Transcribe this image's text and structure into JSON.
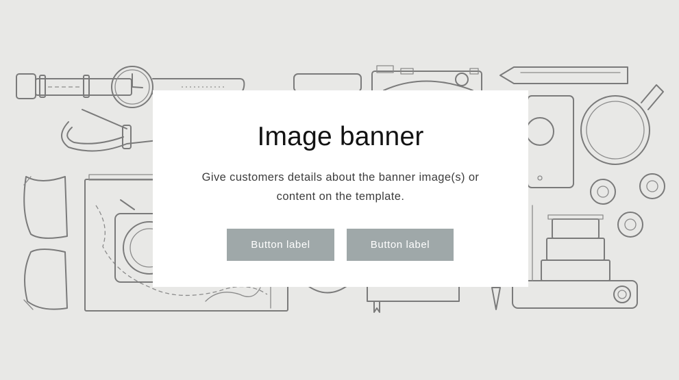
{
  "banner": {
    "title": "Image banner",
    "description": "Give customers details about the banner image(s) or content on the template.",
    "buttons": [
      {
        "label": "Button label"
      },
      {
        "label": "Button label"
      }
    ]
  },
  "colors": {
    "background": "#e8e8e6",
    "card": "#ffffff",
    "button": "#9fa8a9",
    "line_art": "#7a7a7a"
  }
}
